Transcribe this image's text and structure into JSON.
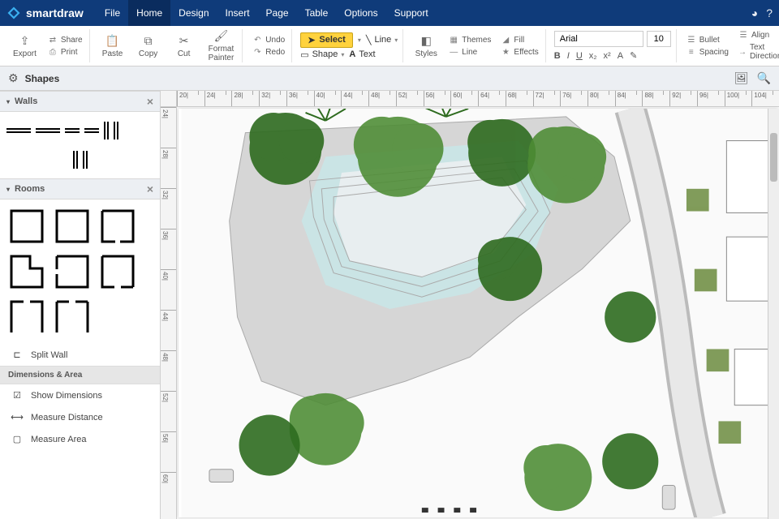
{
  "brand": {
    "name": "smartdraw"
  },
  "menus": [
    "File",
    "Home",
    "Design",
    "Insert",
    "Page",
    "Table",
    "Options",
    "Support"
  ],
  "active_menu": 1,
  "ribbon": {
    "export": "Export",
    "share": "Share",
    "print": "Print",
    "paste": "Paste",
    "copy": "Copy",
    "cut": "Cut",
    "format_painter": "Format Painter",
    "undo": "Undo",
    "redo": "Redo",
    "select": "Select",
    "shape": "Shape",
    "line": "Line",
    "text": "Text",
    "styles": "Styles",
    "themes": "Themes",
    "fill": "Fill",
    "line2": "Line",
    "effects": "Effects",
    "font_name": "Arial",
    "font_size": "10",
    "bold": "B",
    "italic": "I",
    "underline": "U",
    "sub": "x₂",
    "sup": "x²",
    "fontcolor": "A",
    "highlight": "✎",
    "bullet": "Bullet",
    "align": "Align",
    "spacing": "Spacing",
    "textdir": "Text Direction"
  },
  "shapesbar": {
    "title": "Shapes"
  },
  "sections": {
    "walls": "Walls",
    "rooms": "Rooms",
    "dimarea": "Dimensions & Area",
    "split_wall": "Split Wall",
    "show_dim": "Show Dimensions",
    "measure_dist": "Measure Distance",
    "measure_area": "Measure Area"
  },
  "ruler_h": [
    "20|",
    "24|",
    "28|",
    "32|",
    "36|",
    "40|",
    "44|",
    "48|",
    "52|",
    "56|",
    "60|",
    "64|",
    "68|",
    "72|",
    "76|",
    "80|",
    "84|",
    "88|",
    "92|",
    "96|",
    "100|",
    "104|"
  ],
  "ruler_v": [
    "24|",
    "28|",
    "32|",
    "36|",
    "40|",
    "44|",
    "48|",
    "52|",
    "56|",
    "60|"
  ]
}
